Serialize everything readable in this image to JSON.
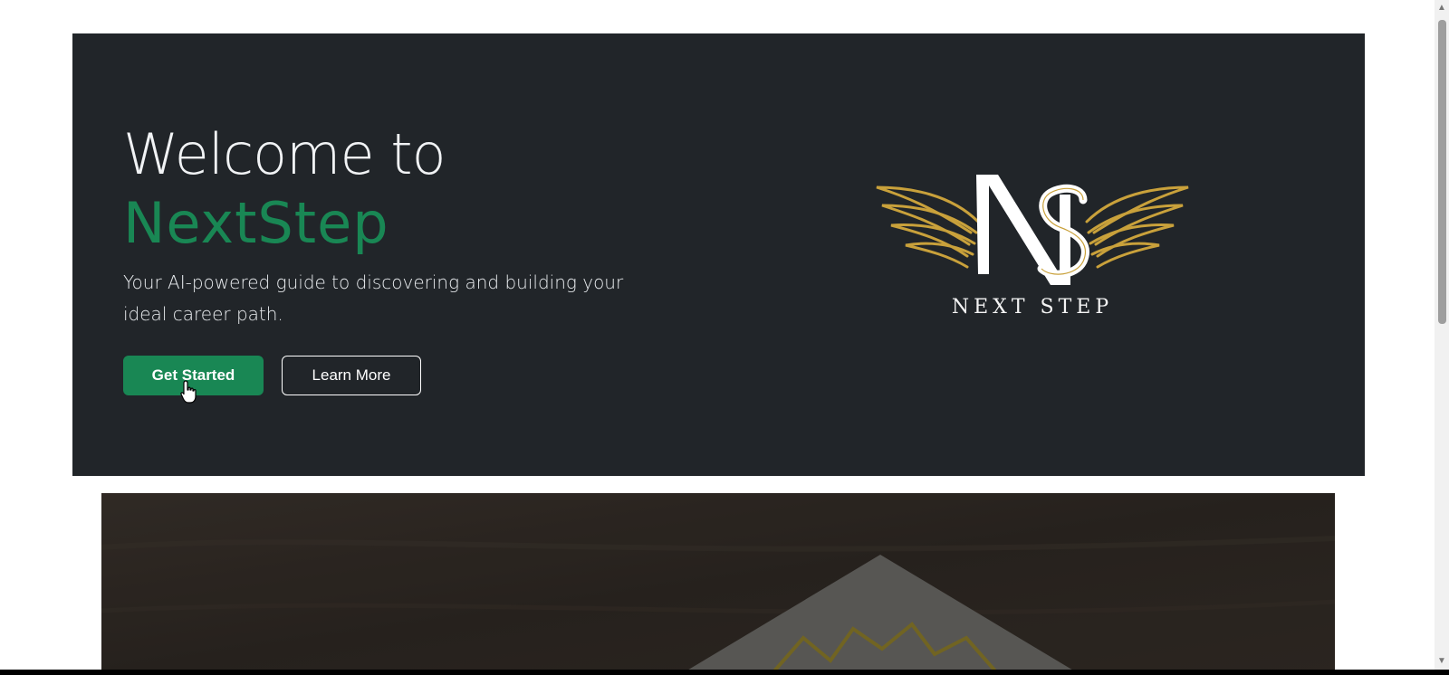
{
  "hero": {
    "title_line1": "Welcome to",
    "title_brand": "NextStep",
    "subtitle": "Your AI-powered guide to discovering and building your ideal career path.",
    "primary_button": "Get Started",
    "secondary_button": "Learn More"
  },
  "logo": {
    "monogram": "NS",
    "text": "NEXT STEP"
  },
  "colors": {
    "hero_bg": "#212529",
    "brand_green": "#198754",
    "logo_gold": "#c9a13b"
  },
  "icons": {
    "cursor": "hand-pointer-icon",
    "scroll_up": "scroll-up-arrow-icon",
    "scroll_down": "scroll-down-arrow-icon"
  }
}
